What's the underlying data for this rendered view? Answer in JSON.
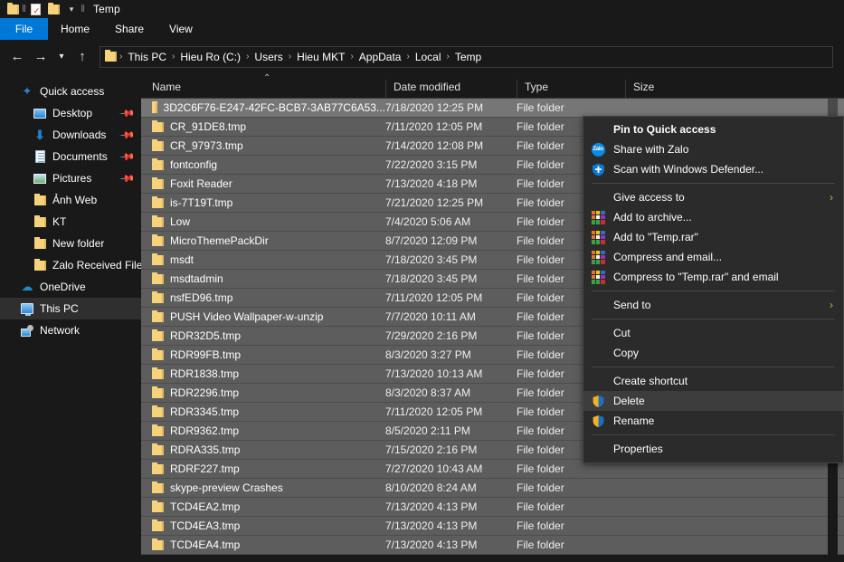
{
  "window": {
    "title": "Temp",
    "quick_access_icons": [
      "folder-icon",
      "properties-icon",
      "new-folder-icon",
      "dropdown-caret-icon"
    ]
  },
  "ribbon": {
    "tabs": [
      {
        "label": "File",
        "active": true
      },
      {
        "label": "Home",
        "active": false
      },
      {
        "label": "Share",
        "active": false
      },
      {
        "label": "View",
        "active": false
      }
    ]
  },
  "addressbar": {
    "back_icon": "back-arrow-icon",
    "forward_icon": "forward-arrow-icon",
    "recent_icon": "chevron-down-icon",
    "up_icon": "up-arrow-icon",
    "breadcrumbs": [
      "This PC",
      "Hieu Ro (C:)",
      "Users",
      "Hieu MKT",
      "AppData",
      "Local",
      "Temp"
    ],
    "separator": "›"
  },
  "sidebar": {
    "items": [
      {
        "label": "Quick access",
        "icon": "star-icon",
        "indent": 0,
        "pinned": false,
        "selected": false
      },
      {
        "label": "Desktop",
        "icon": "desktop-icon",
        "indent": 1,
        "pinned": true,
        "selected": false
      },
      {
        "label": "Downloads",
        "icon": "downloads-icon",
        "indent": 1,
        "pinned": true,
        "selected": false
      },
      {
        "label": "Documents",
        "icon": "documents-icon",
        "indent": 1,
        "pinned": true,
        "selected": false
      },
      {
        "label": "Pictures",
        "icon": "pictures-icon",
        "indent": 1,
        "pinned": true,
        "selected": false
      },
      {
        "label": "Ảnh Web",
        "icon": "folder-icon",
        "indent": 1,
        "pinned": false,
        "selected": false
      },
      {
        "label": "KT",
        "icon": "folder-icon",
        "indent": 1,
        "pinned": false,
        "selected": false
      },
      {
        "label": "New folder",
        "icon": "folder-icon",
        "indent": 1,
        "pinned": false,
        "selected": false
      },
      {
        "label": "Zalo Received Files",
        "icon": "folder-icon",
        "indent": 1,
        "pinned": false,
        "selected": false
      },
      {
        "label": "OneDrive",
        "icon": "onedrive-icon",
        "indent": 0,
        "pinned": false,
        "selected": false
      },
      {
        "label": "This PC",
        "icon": "this-pc-icon",
        "indent": 0,
        "pinned": false,
        "selected": true
      },
      {
        "label": "Network",
        "icon": "network-icon",
        "indent": 0,
        "pinned": false,
        "selected": false
      }
    ]
  },
  "filelist": {
    "columns": [
      "Name",
      "Date modified",
      "Type",
      "Size"
    ],
    "sort_indicator": "⌃",
    "rows": [
      {
        "name": "3D2C6F76-E247-42FC-BCB7-3AB77C6A53...",
        "date": "7/18/2020 12:25 PM",
        "type": "File folder",
        "size": "",
        "selected": true
      },
      {
        "name": "CR_91DE8.tmp",
        "date": "7/11/2020 12:05 PM",
        "type": "File folder",
        "size": "",
        "selected": false
      },
      {
        "name": "CR_97973.tmp",
        "date": "7/14/2020 12:08 PM",
        "type": "File folder",
        "size": "",
        "selected": false
      },
      {
        "name": "fontconfig",
        "date": "7/22/2020 3:15 PM",
        "type": "File folder",
        "size": "",
        "selected": false
      },
      {
        "name": "Foxit Reader",
        "date": "7/13/2020 4:18 PM",
        "type": "File folder",
        "size": "",
        "selected": false
      },
      {
        "name": "is-7T19T.tmp",
        "date": "7/21/2020 12:25 PM",
        "type": "File folder",
        "size": "",
        "selected": false
      },
      {
        "name": "Low",
        "date": "7/4/2020 5:06 AM",
        "type": "File folder",
        "size": "",
        "selected": false
      },
      {
        "name": "MicroThemePackDir",
        "date": "8/7/2020 12:09 PM",
        "type": "File folder",
        "size": "",
        "selected": false
      },
      {
        "name": "msdt",
        "date": "7/18/2020 3:45 PM",
        "type": "File folder",
        "size": "",
        "selected": false
      },
      {
        "name": "msdtadmin",
        "date": "7/18/2020 3:45 PM",
        "type": "File folder",
        "size": "",
        "selected": false
      },
      {
        "name": "nsfED96.tmp",
        "date": "7/11/2020 12:05 PM",
        "type": "File folder",
        "size": "",
        "selected": false
      },
      {
        "name": "PUSH Video Wallpaper-w-unzip",
        "date": "7/7/2020 10:11 AM",
        "type": "File folder",
        "size": "",
        "selected": false
      },
      {
        "name": "RDR32D5.tmp",
        "date": "7/29/2020 2:16 PM",
        "type": "File folder",
        "size": "",
        "selected": false
      },
      {
        "name": "RDR99FB.tmp",
        "date": "8/3/2020 3:27 PM",
        "type": "File folder",
        "size": "",
        "selected": false
      },
      {
        "name": "RDR1838.tmp",
        "date": "7/13/2020 10:13 AM",
        "type": "File folder",
        "size": "",
        "selected": false
      },
      {
        "name": "RDR2296.tmp",
        "date": "8/3/2020 8:37 AM",
        "type": "File folder",
        "size": "",
        "selected": false
      },
      {
        "name": "RDR3345.tmp",
        "date": "7/11/2020 12:05 PM",
        "type": "File folder",
        "size": "",
        "selected": false
      },
      {
        "name": "RDR9362.tmp",
        "date": "8/5/2020 2:11 PM",
        "type": "File folder",
        "size": "",
        "selected": false
      },
      {
        "name": "RDRA335.tmp",
        "date": "7/15/2020 2:16 PM",
        "type": "File folder",
        "size": "",
        "selected": false
      },
      {
        "name": "RDRF227.tmp",
        "date": "7/27/2020 10:43 AM",
        "type": "File folder",
        "size": "",
        "selected": false
      },
      {
        "name": "skype-preview Crashes",
        "date": "8/10/2020 8:24 AM",
        "type": "File folder",
        "size": "",
        "selected": false
      },
      {
        "name": "TCD4EA2.tmp",
        "date": "7/13/2020 4:13 PM",
        "type": "File folder",
        "size": "",
        "selected": false
      },
      {
        "name": "TCD4EA3.tmp",
        "date": "7/13/2020 4:13 PM",
        "type": "File folder",
        "size": "",
        "selected": false
      },
      {
        "name": "TCD4EA4.tmp",
        "date": "7/13/2020 4:13 PM",
        "type": "File folder",
        "size": "",
        "selected": false
      }
    ]
  },
  "contextmenu": {
    "items": [
      {
        "label": "Pin to Quick access",
        "icon": "",
        "bold": true,
        "hover": false,
        "submenu": false,
        "separator_after": false
      },
      {
        "label": "Share with Zalo",
        "icon": "zalo-icon",
        "bold": false,
        "hover": false,
        "submenu": false,
        "separator_after": false
      },
      {
        "label": "Scan with Windows Defender...",
        "icon": "windows-defender-icon",
        "bold": false,
        "hover": false,
        "submenu": false,
        "separator_after": true
      },
      {
        "label": "Give access to",
        "icon": "",
        "bold": false,
        "hover": false,
        "submenu": true,
        "separator_after": false
      },
      {
        "label": "Add to archive...",
        "icon": "winrar-icon",
        "bold": false,
        "hover": false,
        "submenu": false,
        "separator_after": false
      },
      {
        "label": "Add to \"Temp.rar\"",
        "icon": "winrar-icon",
        "bold": false,
        "hover": false,
        "submenu": false,
        "separator_after": false
      },
      {
        "label": "Compress and email...",
        "icon": "winrar-icon",
        "bold": false,
        "hover": false,
        "submenu": false,
        "separator_after": false
      },
      {
        "label": "Compress to \"Temp.rar\" and email",
        "icon": "winrar-icon",
        "bold": false,
        "hover": false,
        "submenu": false,
        "separator_after": true
      },
      {
        "label": "Send to",
        "icon": "",
        "bold": false,
        "hover": false,
        "submenu": true,
        "separator_after": true
      },
      {
        "label": "Cut",
        "icon": "",
        "bold": false,
        "hover": false,
        "submenu": false,
        "separator_after": false
      },
      {
        "label": "Copy",
        "icon": "",
        "bold": false,
        "hover": false,
        "submenu": false,
        "separator_after": true
      },
      {
        "label": "Create shortcut",
        "icon": "",
        "bold": false,
        "hover": false,
        "submenu": false,
        "separator_after": false
      },
      {
        "label": "Delete",
        "icon": "uac-shield-icon",
        "bold": false,
        "hover": true,
        "submenu": false,
        "separator_after": false
      },
      {
        "label": "Rename",
        "icon": "uac-shield-icon",
        "bold": false,
        "hover": false,
        "submenu": false,
        "separator_after": true
      },
      {
        "label": "Properties",
        "icon": "",
        "bold": false,
        "hover": false,
        "submenu": false,
        "separator_after": false
      }
    ],
    "submenu_arrow": "›"
  },
  "colors": {
    "accent": "#0078d7",
    "window_bg": "#191919",
    "row_bg": "#5d5d5d",
    "row_selected": "#767676",
    "menu_bg": "#2b2b2b",
    "menu_hover": "#3d3d3d",
    "folder_yellow": "#f6d37a"
  }
}
